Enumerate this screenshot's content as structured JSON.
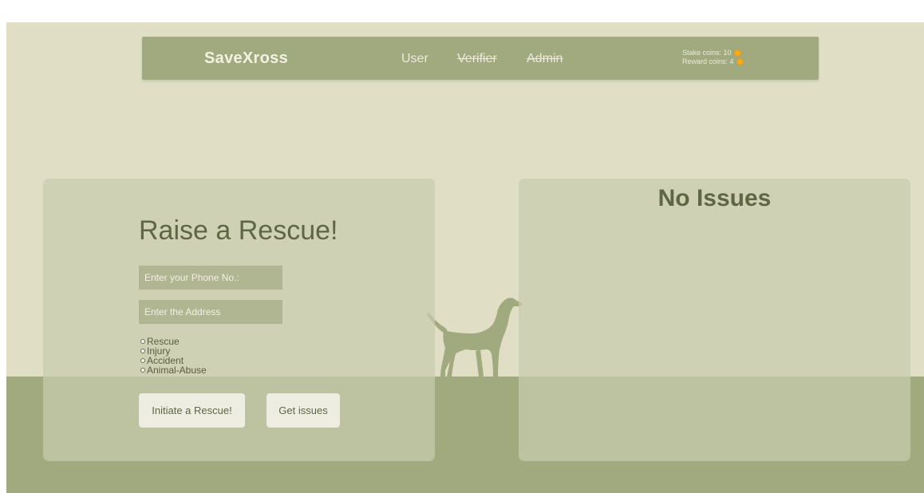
{
  "navbar": {
    "brand": "SaveXross",
    "links": [
      {
        "label": "User"
      },
      {
        "label": "Verifier"
      },
      {
        "label": "Admin"
      }
    ],
    "stake_coins": "Stake coins: 10",
    "reward_coins": "Reward coins: 4"
  },
  "form": {
    "title": "Raise a Rescue!",
    "phone_placeholder": "Enter your Phone No.:",
    "address_placeholder": "Enter the Address",
    "options": [
      "Rescue",
      "Injury",
      "Accident",
      "Animal-Abuse"
    ],
    "initiate_button": "Initiate a Rescue!",
    "get_issues_button": "Get issues"
  },
  "issues": {
    "heading": "No Issues"
  },
  "colors": {
    "background": "#e0dfc6",
    "ground": "#a1aa7e",
    "navbar": "#a1aa7e",
    "panel": "#c8ccae",
    "text": "#5f6646",
    "coin": "#f5ad1e"
  },
  "icons": {
    "coin": "coin-icon",
    "dog": "dog-silhouette"
  }
}
